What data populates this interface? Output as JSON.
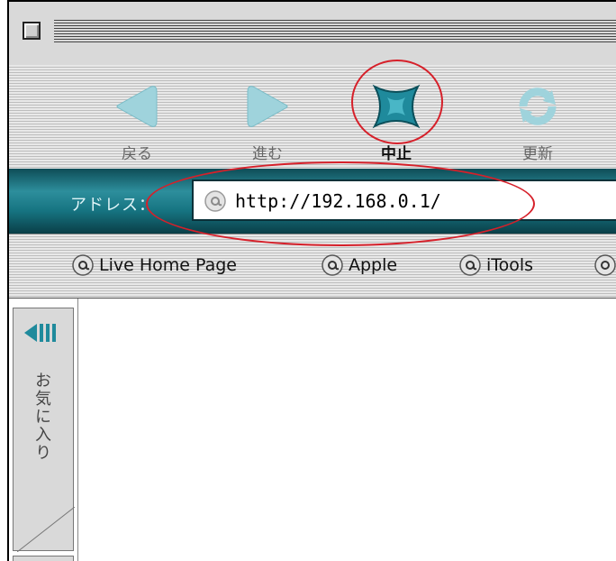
{
  "toolbar": {
    "back_label": "戻る",
    "forward_label": "進む",
    "stop_label": "中止",
    "refresh_label": "更新"
  },
  "address": {
    "label": "アドレス：",
    "url": "http://192.168.0.1/"
  },
  "favorites": [
    {
      "label": "Live Home Page"
    },
    {
      "label": "Apple"
    },
    {
      "label": "iTools"
    }
  ],
  "sidebar": {
    "tab_label": "お気に入り"
  },
  "colors": {
    "accent_teal": "#2d8e9c",
    "annotation_red": "#d6202a"
  }
}
